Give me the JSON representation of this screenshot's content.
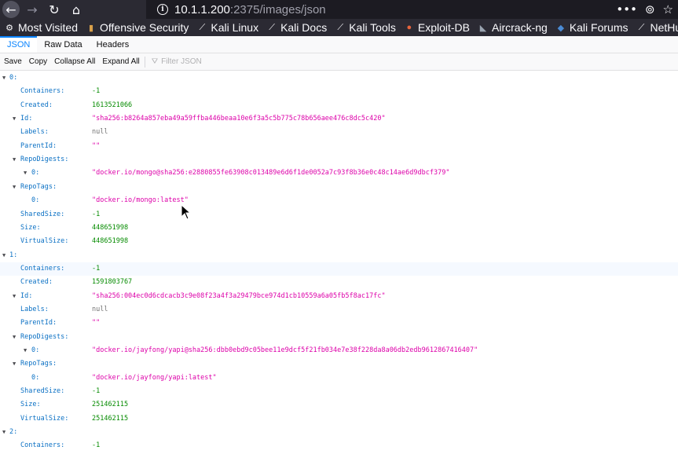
{
  "browser": {
    "url_host": "10.1.1.200",
    "url_path": ":2375/images/json",
    "url_actions": [
      "•••",
      "⊚",
      "☆"
    ]
  },
  "bookmarks": [
    {
      "label": "Most Visited",
      "icon": "gear-icon",
      "glyph": "⚙"
    },
    {
      "label": "Offensive Security",
      "icon": "offsec-icon",
      "glyph": "▮"
    },
    {
      "label": "Kali Linux",
      "icon": "kali-dragon-icon",
      "glyph": "⟋"
    },
    {
      "label": "Kali Docs",
      "icon": "kali-dragon-icon",
      "glyph": "⟋"
    },
    {
      "label": "Kali Tools",
      "icon": "kali-dragon-icon",
      "glyph": "⟋"
    },
    {
      "label": "Exploit-DB",
      "icon": "exploitdb-icon",
      "glyph": "●"
    },
    {
      "label": "Aircrack-ng",
      "icon": "aircrack-icon",
      "glyph": "◣"
    },
    {
      "label": "Kali Forums",
      "icon": "kali-forums-icon",
      "glyph": "◆"
    },
    {
      "label": "NetHu",
      "icon": "nethunter-icon",
      "glyph": "⟋"
    }
  ],
  "tabs": [
    "JSON",
    "Raw Data",
    "Headers"
  ],
  "toolbar": {
    "buttons": [
      "Save",
      "Copy",
      "Collapse All",
      "Expand All"
    ],
    "filter_placeholder": "Filter JSON"
  },
  "tree": [
    {
      "indent": 0,
      "twisty": true,
      "key": "0:",
      "value": "",
      "type": "obj"
    },
    {
      "indent": 1,
      "twisty": false,
      "key": "Containers:",
      "value": "-1",
      "type": "num"
    },
    {
      "indent": 1,
      "twisty": false,
      "key": "Created:",
      "value": "1613521066",
      "type": "num"
    },
    {
      "indent": 1,
      "twisty": true,
      "key": "Id:",
      "value": "\"sha256:b8264a857eba49a59ffba446beaa10e6f3a5c5b775c78b656aee476c8dc5c420\"",
      "type": "str"
    },
    {
      "indent": 1,
      "twisty": false,
      "key": "Labels:",
      "value": "null",
      "type": "nul"
    },
    {
      "indent": 1,
      "twisty": false,
      "key": "ParentId:",
      "value": "\"\"",
      "type": "str"
    },
    {
      "indent": 1,
      "twisty": true,
      "key": "RepoDigests:",
      "value": "",
      "type": "obj"
    },
    {
      "indent": 2,
      "twisty": true,
      "key": "0:",
      "value": "\"docker.io/mongo@sha256:e2880855fe63908c013489e6d6f1de0052a7c93f8b36e0c48c14ae6d9dbcf379\"",
      "type": "str"
    },
    {
      "indent": 1,
      "twisty": true,
      "key": "RepoTags:",
      "value": "",
      "type": "obj"
    },
    {
      "indent": 2,
      "twisty": false,
      "key": "0:",
      "value": "\"docker.io/mongo:latest\"",
      "type": "str"
    },
    {
      "indent": 1,
      "twisty": false,
      "key": "SharedSize:",
      "value": "-1",
      "type": "num"
    },
    {
      "indent": 1,
      "twisty": false,
      "key": "Size:",
      "value": "448651998",
      "type": "num"
    },
    {
      "indent": 1,
      "twisty": false,
      "key": "VirtualSize:",
      "value": "448651998",
      "type": "num"
    },
    {
      "indent": 0,
      "twisty": true,
      "key": "1:",
      "value": "",
      "type": "obj"
    },
    {
      "indent": 1,
      "twisty": false,
      "key": "Containers:",
      "value": "-1",
      "type": "num"
    },
    {
      "indent": 1,
      "twisty": false,
      "key": "Created:",
      "value": "1591803767",
      "type": "num"
    },
    {
      "indent": 1,
      "twisty": true,
      "key": "Id:",
      "value": "\"sha256:004ec0d6cdcacb3c9e08f23a4f3a29479bce974d1cb10559a6a05fb5f8ac17fc\"",
      "type": "str"
    },
    {
      "indent": 1,
      "twisty": false,
      "key": "Labels:",
      "value": "null",
      "type": "nul"
    },
    {
      "indent": 1,
      "twisty": false,
      "key": "ParentId:",
      "value": "\"\"",
      "type": "str"
    },
    {
      "indent": 1,
      "twisty": true,
      "key": "RepoDigests:",
      "value": "",
      "type": "obj"
    },
    {
      "indent": 2,
      "twisty": true,
      "key": "0:",
      "value": "\"docker.io/jayfong/yapi@sha256:dbb0ebd9c05bee11e9dcf5f21fb034e7e38f228da8a06db2edb9612867416407\"",
      "type": "str"
    },
    {
      "indent": 1,
      "twisty": true,
      "key": "RepoTags:",
      "value": "",
      "type": "obj"
    },
    {
      "indent": 2,
      "twisty": false,
      "key": "0:",
      "value": "\"docker.io/jayfong/yapi:latest\"",
      "type": "str"
    },
    {
      "indent": 1,
      "twisty": false,
      "key": "SharedSize:",
      "value": "-1",
      "type": "num"
    },
    {
      "indent": 1,
      "twisty": false,
      "key": "Size:",
      "value": "251462115",
      "type": "num"
    },
    {
      "indent": 1,
      "twisty": false,
      "key": "VirtualSize:",
      "value": "251462115",
      "type": "num"
    },
    {
      "indent": 0,
      "twisty": true,
      "key": "2:",
      "value": "",
      "type": "obj"
    },
    {
      "indent": 1,
      "twisty": false,
      "key": "Containers:",
      "value": "-1",
      "type": "num"
    }
  ]
}
